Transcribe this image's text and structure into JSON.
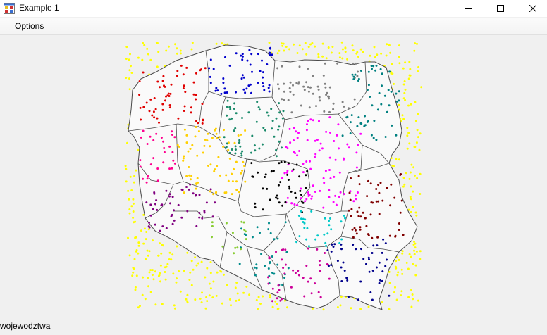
{
  "window": {
    "title": "Example 1",
    "icon": "app-window-icon",
    "controls": [
      "minimize-icon",
      "maximize-icon",
      "close-icon"
    ]
  },
  "menu": {
    "items": [
      {
        "label": "Options"
      }
    ]
  },
  "map": {
    "regions": [
      {
        "color": "#e00000",
        "count": 60
      },
      {
        "color": "#0000cc",
        "count": 55
      },
      {
        "color": "#808080",
        "count": 60
      },
      {
        "color": "#008080",
        "count": 55
      },
      {
        "color": "#1a8a6a",
        "count": 60
      },
      {
        "color": "#ff00ff",
        "count": 95
      },
      {
        "color": "#ffd000",
        "count": 75
      },
      {
        "color": "#ff0090",
        "count": 30
      },
      {
        "color": "#000000",
        "count": 45
      },
      {
        "color": "#800000",
        "count": 55
      },
      {
        "color": "#800080",
        "count": 50
      },
      {
        "color": "#00c8c8",
        "count": 30
      },
      {
        "color": "#88cc33",
        "count": 15
      },
      {
        "color": "#008b8b",
        "count": 35
      },
      {
        "color": "#cc0099",
        "count": 45
      },
      {
        "color": "#00008b",
        "count": 45
      }
    ],
    "outside_points": {
      "color": "#ffff00",
      "count": 380
    },
    "outline_color": "#4a4a4a",
    "fill_color": "#fafafa"
  },
  "status": {
    "label": "wojewodztwa"
  }
}
